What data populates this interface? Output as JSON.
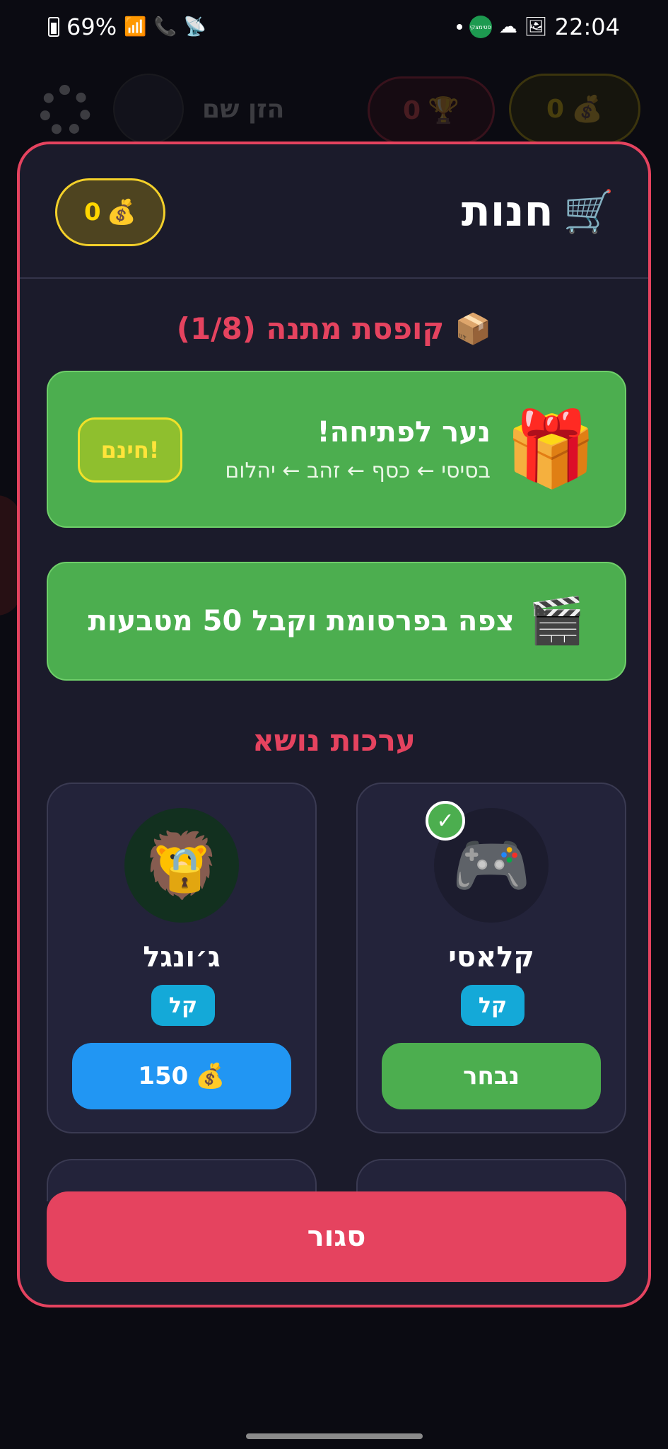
{
  "status_bar": {
    "battery": "69%",
    "time": "22:04",
    "app_badge": "סטימצקי"
  },
  "background_header": {
    "name_placeholder": "הזן שם",
    "trophies": "0",
    "coins": "0"
  },
  "shop": {
    "title": "חנות",
    "coins": "0",
    "gift_section_title": "📦 קופסת מתנה (1/8)",
    "gift_card": {
      "title": "נער לפתיחה!",
      "subtitle": "בסיסי ← כסף ← זהב ← יהלום",
      "free_label": "חינם!"
    },
    "ad_card": {
      "label": "צפה בפרסומת וקבל 50 מטבעות"
    },
    "themes_title": "ערכות נושא",
    "themes": [
      {
        "name": "קלאסי",
        "difficulty": "קל",
        "button_label": "נבחר",
        "selected": true,
        "icon": "gamepad-icon"
      },
      {
        "name": "ג׳ונגל",
        "difficulty": "קל",
        "price": "150",
        "locked": true,
        "icon": "lion-icon"
      }
    ],
    "close_label": "סגור"
  },
  "colors": {
    "accent": "#e5435f",
    "green": "#4cae4f",
    "blue": "#2196f3",
    "gold": "#ffd600"
  }
}
